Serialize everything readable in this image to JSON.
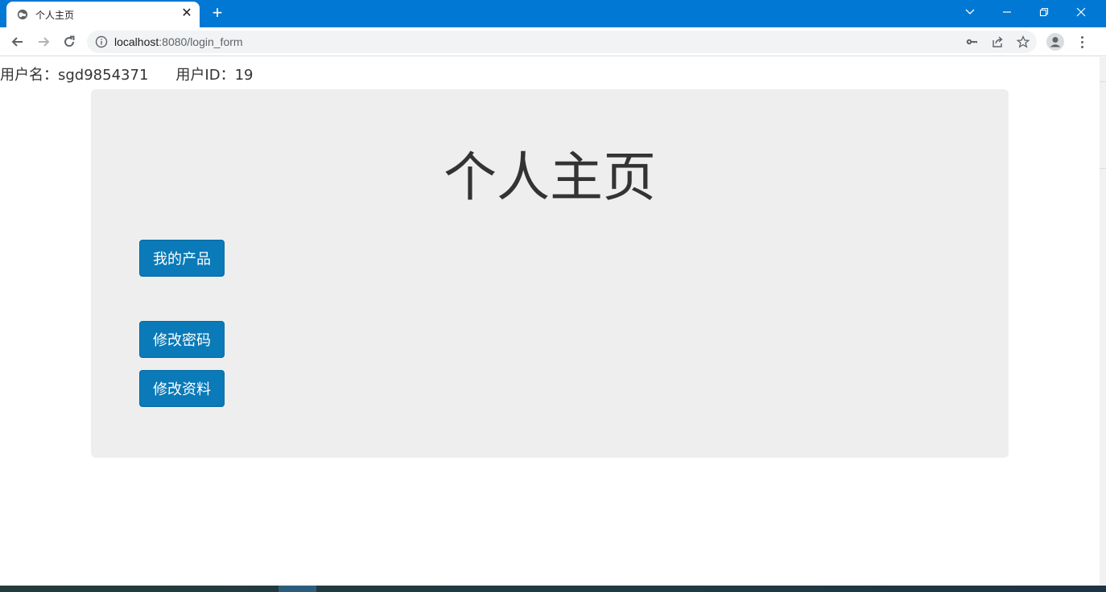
{
  "browser": {
    "tab": {
      "title": "个人主页",
      "close_glyph": "✕"
    },
    "new_tab_glyph": "+",
    "url": {
      "host": "localhost",
      "rest": ":8080/login_form"
    },
    "icons": {
      "favicon": "globe-icon",
      "back": "arrow-left-icon",
      "forward": "arrow-right-icon",
      "reload": "reload-icon",
      "site_info": "info-icon",
      "password": "key-icon",
      "share": "share-icon",
      "bookmark": "star-icon",
      "profile": "avatar-icon",
      "menu": "more-vertical-icon"
    },
    "colors": {
      "tabstrip": "#0078d4",
      "omnibox": "#f1f3f4"
    }
  },
  "userbar": {
    "username_label": "用户名：",
    "username": "sgd9854371",
    "userid_label": "用户ID：",
    "userid": "19"
  },
  "main": {
    "title": "个人主页",
    "buttons": {
      "my_products": "我的产品",
      "change_password": "修改密码",
      "edit_profile": "修改资料"
    },
    "colors": {
      "panel": "#eeeeee",
      "button": "#0a7ab8",
      "button_text": "#ffffff"
    }
  }
}
